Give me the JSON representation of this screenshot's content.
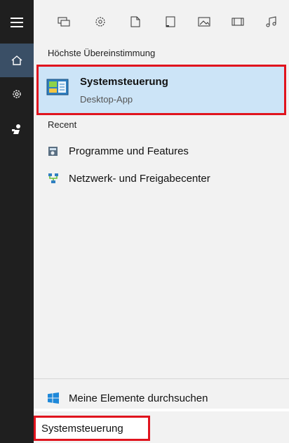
{
  "rail": {
    "items": [
      {
        "icon": "hamburger-menu-icon"
      },
      {
        "icon": "home-icon"
      },
      {
        "icon": "settings-gear-icon"
      },
      {
        "icon": "feedback-person-icon"
      }
    ]
  },
  "filters": {
    "icons": [
      "apps-icon",
      "settings-icon",
      "documents-icon",
      "folders-icon",
      "photos-icon",
      "videos-icon",
      "music-icon"
    ]
  },
  "results": {
    "best_match_header": "Höchste Übereinstimmung",
    "best_match": {
      "title": "Systemsteuerung",
      "subtitle": "Desktop-App",
      "icon": "control-panel-icon"
    },
    "recent_header": "Recent",
    "recent_items": [
      {
        "label": "Programme und Features",
        "icon": "programs-features-icon"
      },
      {
        "label": "Netzwerk- und Freigabecenter",
        "icon": "network-sharing-icon"
      }
    ]
  },
  "bottom": {
    "my_stuff_label": "Meine Elemente durchsuchen",
    "search_value": "Systemsteuerung"
  },
  "colors": {
    "rail_bg": "#1f1f1f",
    "active_rail": "#3a4f66",
    "best_match_bg": "#cce4f7",
    "highlight_outline": "#e0141e"
  }
}
